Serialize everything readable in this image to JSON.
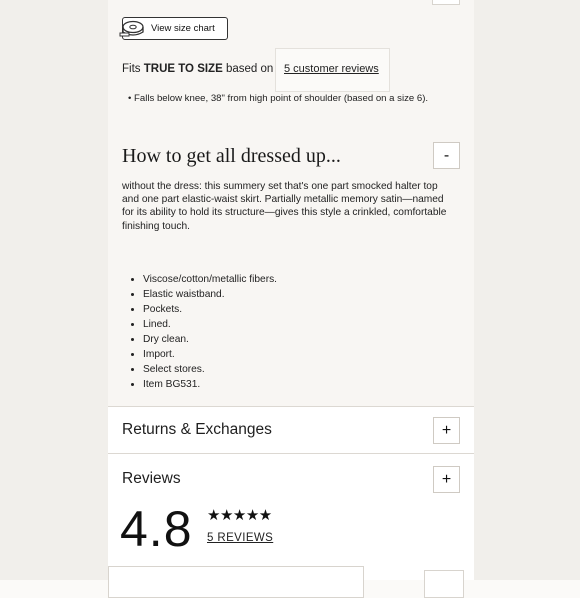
{
  "size_chart": {
    "button_label": "View size chart"
  },
  "fit": {
    "prefix": "Fits",
    "emphasis": "TRUE TO SIZE",
    "suffix": "based on",
    "reviews_link": "5 customer reviews",
    "detail": "Falls below knee, 38\" from high point of shoulder (based on a size 6)."
  },
  "details": {
    "title": "How to get all dressed up...",
    "toggle": "-",
    "description": "without the dress: this summery set that's one part smocked halter top and one part elastic-waist skirt. Partially metallic memory satin—named for its ability to hold its structure—gives this style a crinkled, comfortable finishing touch.",
    "features": [
      "Viscose/cotton/metallic fibers.",
      "Elastic waistband.",
      "Pockets.",
      "Lined.",
      "Dry clean.",
      "Import.",
      "Select stores.",
      "Item BG531."
    ]
  },
  "returns": {
    "title": "Returns & Exchanges",
    "toggle": "+"
  },
  "reviews": {
    "title": "Reviews",
    "toggle": "+",
    "rating": "4.8",
    "stars": "★★★★★",
    "count_link": "5 REVIEWS"
  }
}
